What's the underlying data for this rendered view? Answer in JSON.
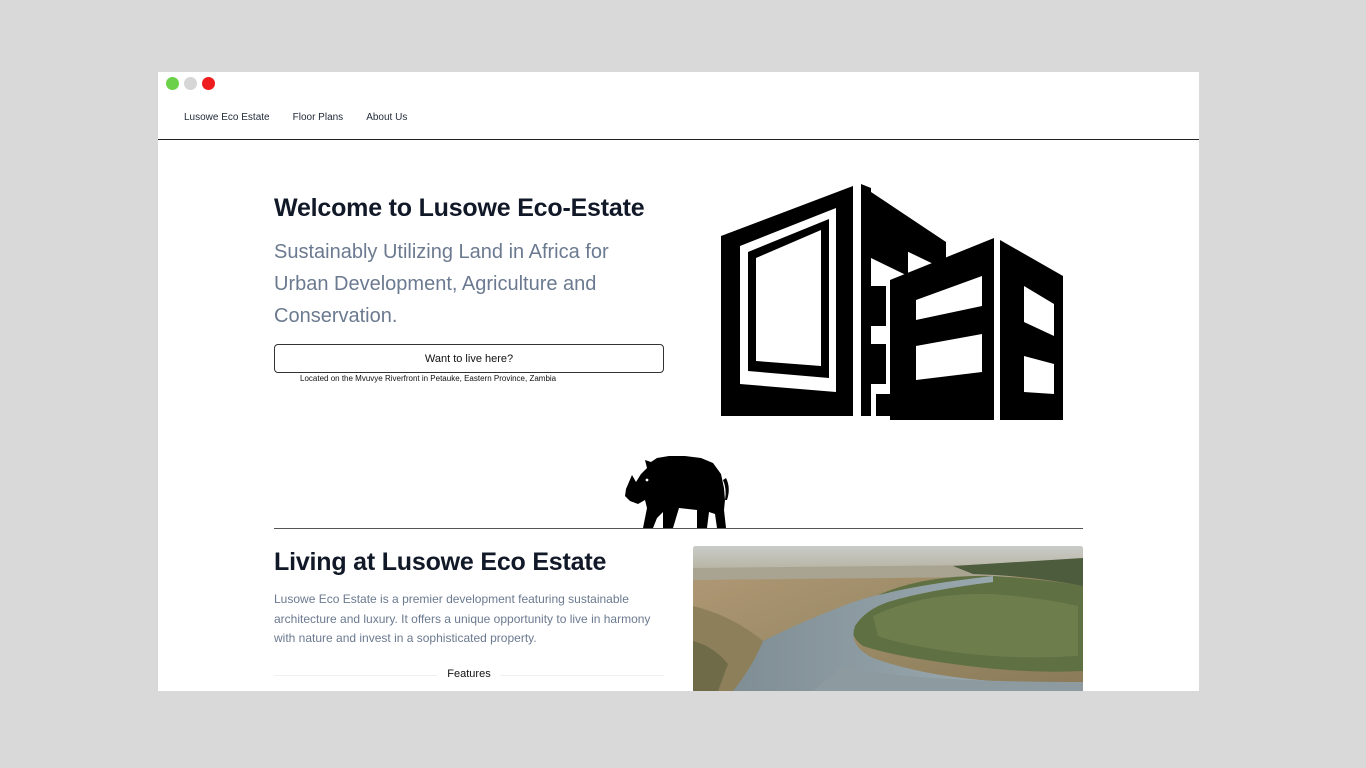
{
  "window_controls": {
    "colors": {
      "green": "#6bd14a",
      "gray": "#d6d6d6",
      "red": "#ee1c1c"
    }
  },
  "nav": {
    "items": [
      {
        "label": "Lusowe Eco Estate"
      },
      {
        "label": "Floor Plans"
      },
      {
        "label": "About Us"
      }
    ]
  },
  "hero": {
    "title": "Welcome to Lusowe Eco-Estate",
    "subtitle": "Sustainably Utilizing Land in Africa for Urban Development, Agriculture and Conservation.",
    "cta_label": "Want to live here?",
    "location": "Located on the Mvuvye Riverfront in Petauke, Eastern Province, Zambia",
    "illustration_icon": "building-icon"
  },
  "rhino": {
    "icon": "rhino-icon"
  },
  "living": {
    "title": "Living at Lusowe Eco Estate",
    "text": "Lusowe Eco Estate is a premier development featuring sustainable architecture and luxury. It offers a unique opportunity to live in harmony with nature and invest in a sophisticated property.",
    "features_label": "Features",
    "photo_icon": "river-aerial-photo"
  },
  "colors": {
    "heading": "#111827",
    "muted_text": "#6b7a90",
    "page_background": "#d9d9d9"
  }
}
